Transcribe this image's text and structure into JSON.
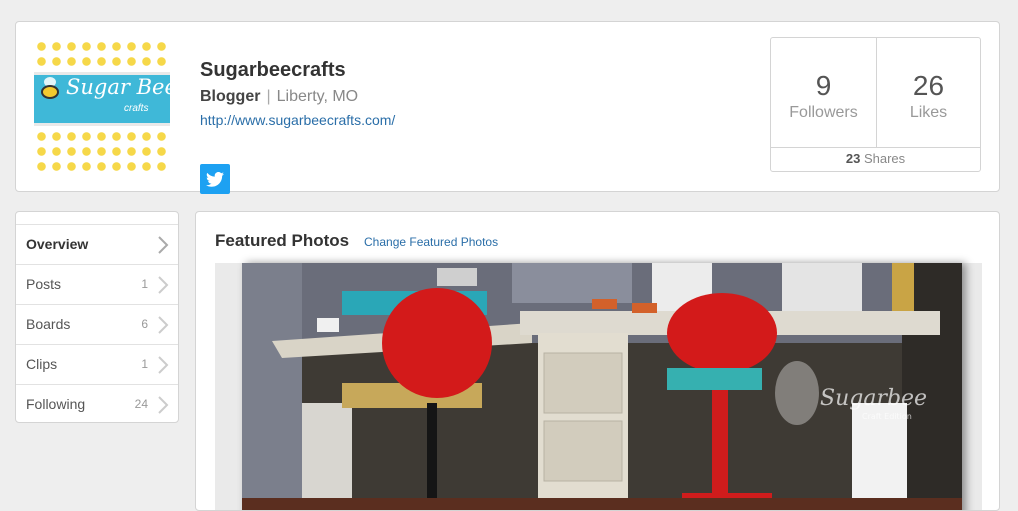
{
  "profile": {
    "name": "Sugarbeecrafts",
    "role": "Blogger",
    "separator": "|",
    "location": "Liberty, MO",
    "website": "http://www.sugarbeecrafts.com/",
    "logo_title": "Sugar Bee",
    "logo_subtitle": "crafts"
  },
  "stats": {
    "followers_count": "9",
    "followers_label": "Followers",
    "likes_count": "26",
    "likes_label": "Likes",
    "shares_count": "23",
    "shares_label": "Shares"
  },
  "nav": {
    "items": [
      {
        "label": "Overview",
        "count": ""
      },
      {
        "label": "Posts",
        "count": "1"
      },
      {
        "label": "Boards",
        "count": "6"
      },
      {
        "label": "Clips",
        "count": "1"
      },
      {
        "label": "Following",
        "count": "24"
      }
    ]
  },
  "featured": {
    "title": "Featured Photos",
    "change_link": "Change Featured Photos",
    "watermark": "Sugarbee",
    "watermark_sub": "Craft Edition"
  },
  "colors": {
    "link": "#2a6ea8",
    "twitter": "#1da1f2",
    "logo_band": "#3fb8d8",
    "logo_dots": "#f6d849",
    "chair_red": "#d31a1a",
    "shelf_teal": "#2aa7b7"
  },
  "icons": {
    "social": "twitter-icon",
    "nav_arrow": "chevron-right-icon"
  }
}
